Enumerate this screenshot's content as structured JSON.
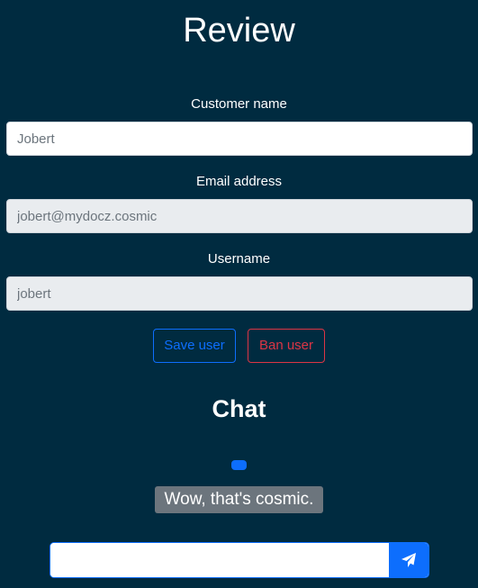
{
  "page": {
    "title": "Review",
    "background_color": "#002b40"
  },
  "form": {
    "customer_name": {
      "label": "Customer name",
      "value": "",
      "placeholder": "Jobert"
    },
    "email": {
      "label": "Email address",
      "value": "",
      "placeholder": "jobert@mydocz.cosmic"
    },
    "username": {
      "label": "Username",
      "value": "",
      "placeholder": "jobert"
    },
    "save_button_label": "Save user",
    "ban_button_label": "Ban user"
  },
  "chat": {
    "title": "Chat",
    "messages": [
      {
        "sender": "self",
        "text": ""
      },
      {
        "sender": "other",
        "text": "Wow, that's cosmic."
      }
    ],
    "composer": {
      "value": "",
      "placeholder": "",
      "send_icon": "paper-plane-icon"
    }
  },
  "colors": {
    "primary": "#0d6efd",
    "danger": "#dc3545",
    "secondary": "#6c757d",
    "readonly_field": "#e9ecef"
  }
}
